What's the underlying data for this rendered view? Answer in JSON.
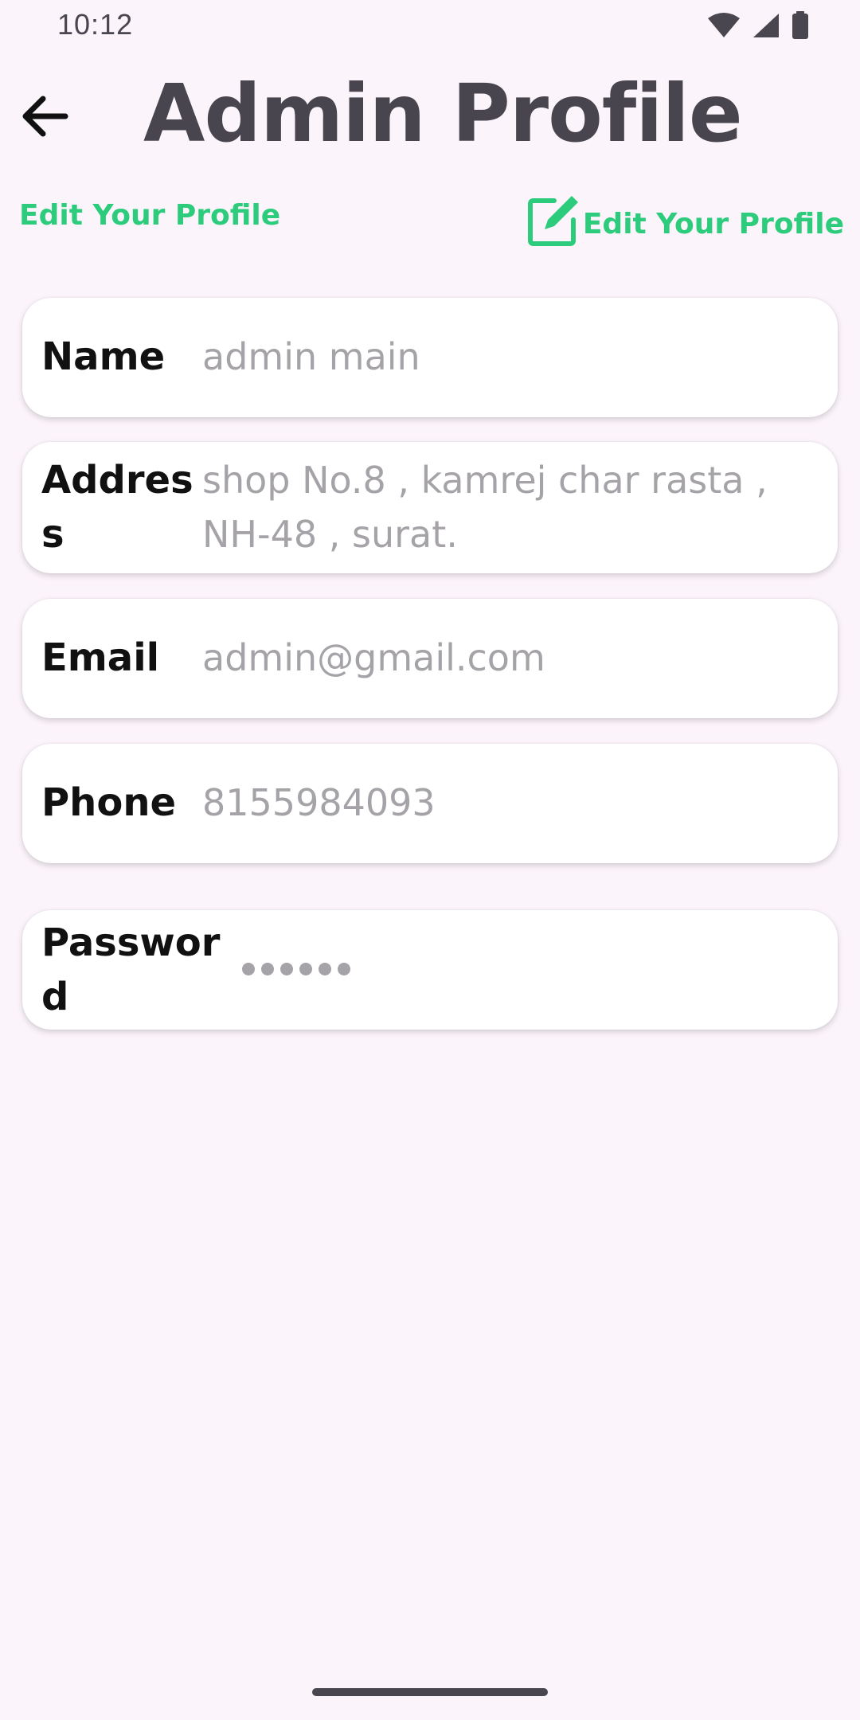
{
  "status_bar": {
    "time": "10:12",
    "icons": [
      "wifi-icon",
      "signal-icon",
      "battery-icon"
    ]
  },
  "header": {
    "back_icon": "arrow-left-icon",
    "title": "Admin Profile"
  },
  "actions": {
    "edit_link_label": "Edit Your Profile",
    "edit_button_label": "Edit Your Profile",
    "edit_button_icon": "edit-icon"
  },
  "fields": {
    "name": {
      "label": "Name",
      "value": "admin main"
    },
    "address": {
      "label": "Address",
      "value": "shop No.8 , kamrej char rasta , NH-48 , surat."
    },
    "email": {
      "label": "Email",
      "value": "admin@gmail.com"
    },
    "phone": {
      "label": "Phone",
      "value": "8155984093"
    },
    "password": {
      "label": "Password",
      "masked_length": 6
    }
  },
  "colors": {
    "accent": "#2dcb7c",
    "background": "#fcf4fb",
    "title": "#48454e",
    "value_text": "#a6a3a8"
  }
}
